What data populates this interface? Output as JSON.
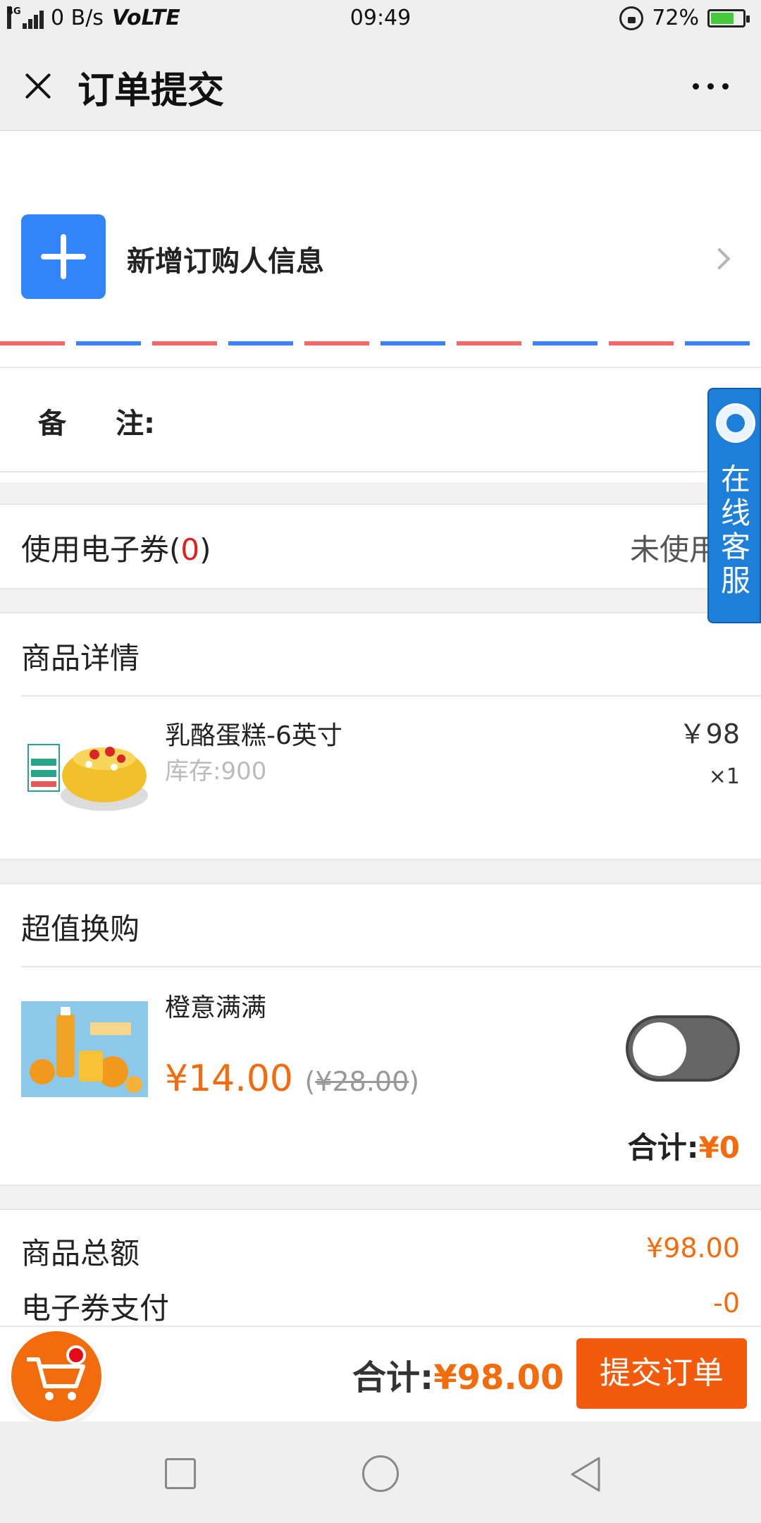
{
  "status_bar": {
    "network_tag": "4G",
    "speed": "0 B/s",
    "volte": "VoLTE",
    "time": "09:49",
    "battery": "72%",
    "battery_level": 0.72
  },
  "header": {
    "title": "订单提交",
    "close_icon": "close-icon",
    "more_icon": "more-icon"
  },
  "buyer": {
    "add_label": "新增订购人信息",
    "icon": "plus-icon"
  },
  "remark": {
    "label_a": "备",
    "label_b": "注:"
  },
  "coupon": {
    "label": "使用电子券(",
    "count": "0",
    "label_end": ")",
    "status": "未使用"
  },
  "product_section": {
    "title": "商品详情",
    "items": [
      {
        "name": "乳酪蛋糕-6英寸",
        "stock": "库存:900",
        "price": "￥98",
        "qty": "×1"
      }
    ]
  },
  "swap_section": {
    "title": "超值换购",
    "item": {
      "name": "橙意满满",
      "price": "¥14.00",
      "old_price": "¥28.00",
      "selected": false
    },
    "total_label": "合计:",
    "total_value": "¥0"
  },
  "summary": {
    "goods_total_label": "商品总额",
    "goods_total_value": "¥98.00",
    "coupon_pay_label": "电子券支付",
    "coupon_pay_value": "-0"
  },
  "floating_service": {
    "text": "在线客服",
    "icon": "customer-service-icon"
  },
  "bottom_bar": {
    "total_label": "合计:",
    "total_value": "¥98.00",
    "submit_label": "提交订单",
    "cart_icon": "cart-icon"
  },
  "colors": {
    "accent_orange": "#f26c0d",
    "blue": "#3385f7",
    "service_blue": "#1e7fd8",
    "red": "#e02020"
  }
}
